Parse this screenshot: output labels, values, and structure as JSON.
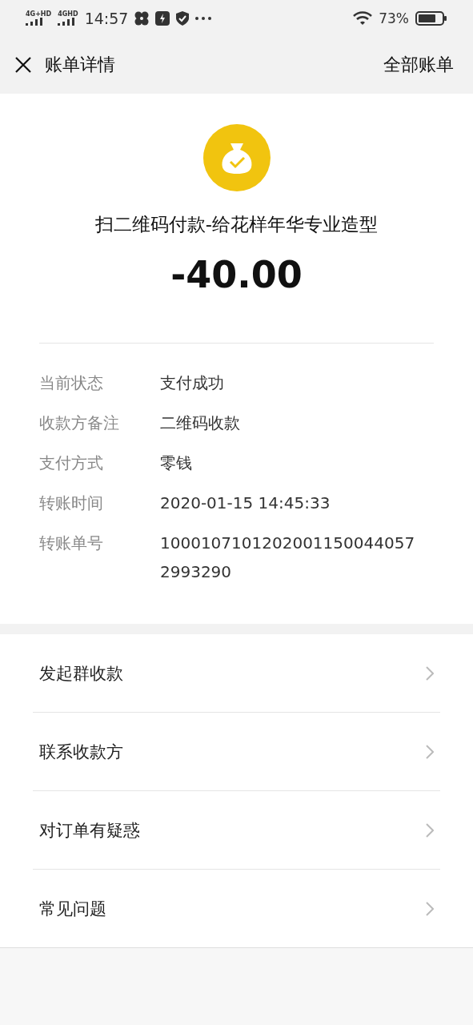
{
  "status_bar": {
    "network_1": "4G+HD",
    "network_2": "4GHD",
    "time": "14:57",
    "battery": "73%"
  },
  "nav": {
    "title": "账单详情",
    "action": "全部账单"
  },
  "summary": {
    "title": "扫二维码付款-给花样年华专业造型",
    "amount": "-40.00"
  },
  "details": [
    {
      "label": "当前状态",
      "value": "支付成功"
    },
    {
      "label": "收款方备注",
      "value": "二维码收款"
    },
    {
      "label": "支付方式",
      "value": "零钱"
    },
    {
      "label": "转账时间",
      "value": "2020-01-15 14:45:33"
    },
    {
      "label": "转账单号",
      "value": "10001071012020011500440572993290"
    }
  ],
  "menu": [
    {
      "label": "发起群收款"
    },
    {
      "label": "联系收款方"
    },
    {
      "label": "对订单有疑惑"
    },
    {
      "label": "常见问题"
    }
  ]
}
